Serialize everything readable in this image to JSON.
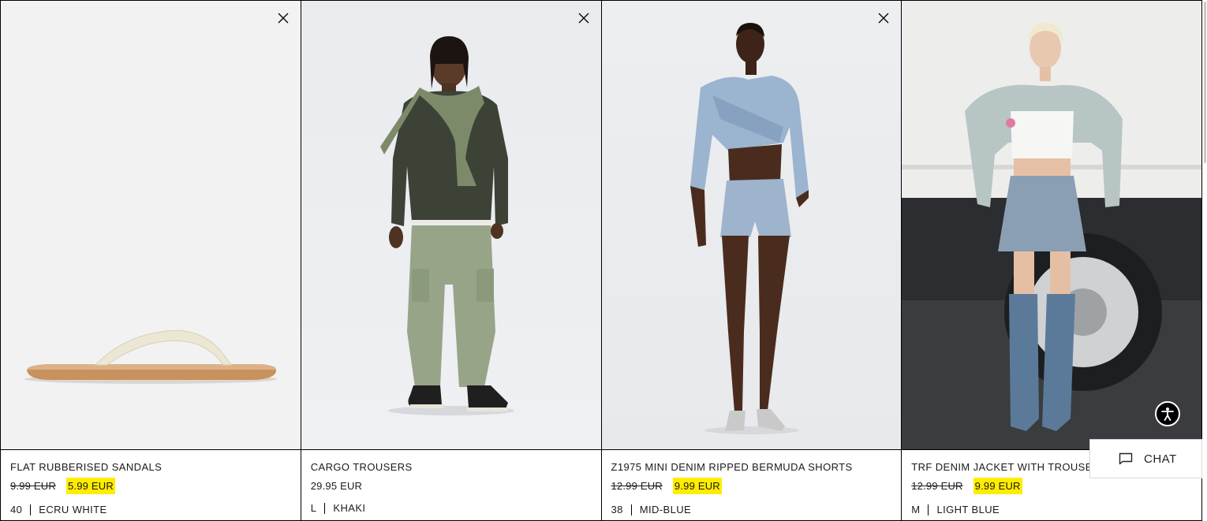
{
  "products": [
    {
      "name": "FLAT RUBBERISED SANDALS",
      "old_price": "9.99 EUR",
      "price": "5.99 EUR",
      "size": "40",
      "color": "ECRU WHITE",
      "image": "flat-sandal-image"
    },
    {
      "name": "CARGO TROUSERS",
      "price": "29.95 EUR",
      "size": "L",
      "color": "KHAKI",
      "image": "cargo-trousers-model-image"
    },
    {
      "name": "Z1975 MINI DENIM RIPPED BERMUDA SHORTS",
      "old_price": "12.99 EUR",
      "price": "9.99 EUR",
      "size": "38",
      "color": "MID-BLUE",
      "image": "denim-shorts-model-image"
    },
    {
      "name": "TRF DENIM JACKET WITH TROUSERS",
      "old_price": "12.99 EUR",
      "price": "9.99 EUR",
      "size": "M",
      "color": "LIGHT BLUE",
      "image": "denim-jacket-model-image"
    }
  ],
  "chat": {
    "label": "CHAT"
  },
  "icons": {
    "remove": "close-icon",
    "chat": "chat-bubble-icon",
    "accessibility": "accessibility-icon"
  },
  "colors": {
    "sale_highlight": "#ffec00",
    "border": "#000000"
  }
}
